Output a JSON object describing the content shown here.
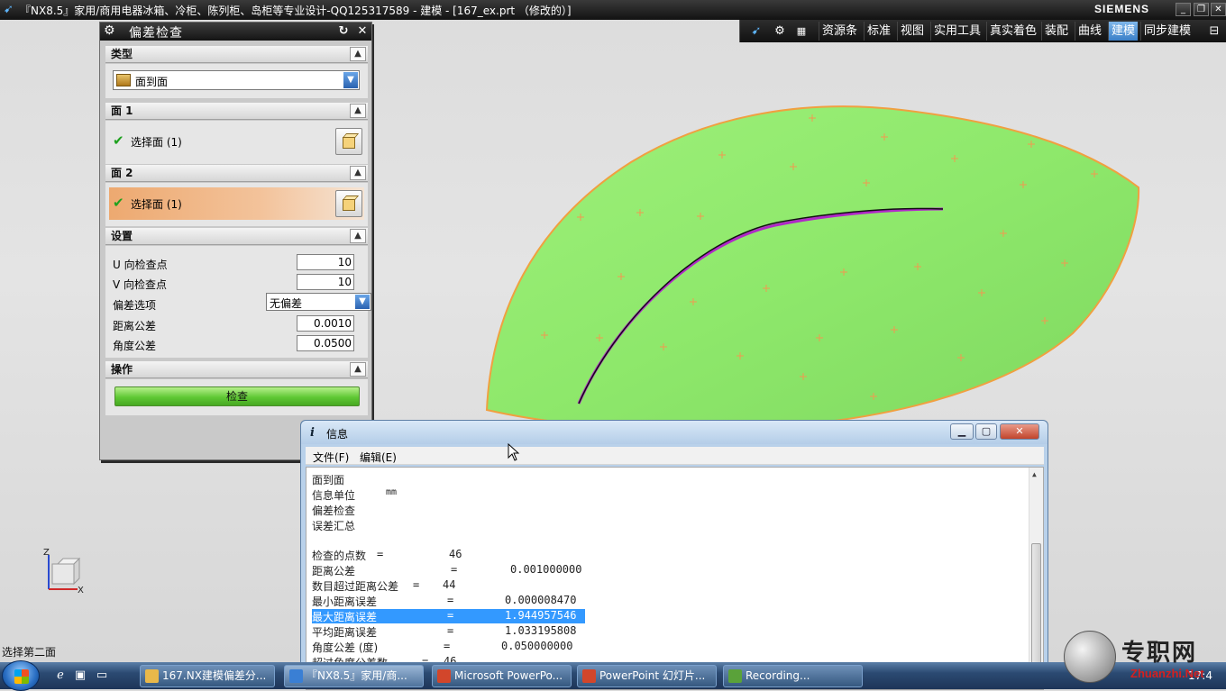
{
  "window": {
    "title": "『NX8.5』家用/商用电器冰箱、冷柜、陈列柜、岛柜等专业设计-QQ125317589 - 建模 - [167_ex.prt （修改的）]",
    "brand": "SIEMENS"
  },
  "toolbar": {
    "tabs": [
      "资源条",
      "标准",
      "视图",
      "实用工具",
      "真实着色",
      "装配",
      "曲线",
      "建模",
      "同步建模"
    ],
    "active_tab": "建模"
  },
  "dialog": {
    "title": "偏差检查",
    "type_section": {
      "label": "类型",
      "value": "面到面"
    },
    "face1_section": {
      "label": "面 1",
      "selection": "选择面 (1)"
    },
    "face2_section": {
      "label": "面 2",
      "selection": "选择面 (1)"
    },
    "settings_section": {
      "label": "设置",
      "u_points_label": "U 向检查点",
      "u_points": "10",
      "v_points_label": "V 向检查点",
      "v_points": "10",
      "deviation_option_label": "偏差选项",
      "deviation_option": "无偏差",
      "distance_tol_label": "距离公差",
      "distance_tol": "0.0010",
      "angle_tol_label": "角度公差",
      "angle_tol": "0.0500"
    },
    "operation_section": {
      "label": "操作",
      "check_button": "检查"
    }
  },
  "info_window": {
    "title": "信息",
    "menu": [
      "文件(F)",
      "编辑(E)"
    ],
    "lines": [
      {
        "key": "面到面",
        "eq": "",
        "value": ""
      },
      {
        "key": "信息单位",
        "eq": "",
        "value": "mm"
      },
      {
        "key": "偏差检查",
        "eq": "",
        "value": ""
      },
      {
        "key": "误差汇总",
        "eq": "",
        "value": ""
      },
      {
        "key": "",
        "eq": "",
        "value": ""
      },
      {
        "key": "检查的点数",
        "eq": "=",
        "value": "46"
      },
      {
        "key": "距离公差",
        "eq": "=",
        "value": "0.001000000"
      },
      {
        "key": "数目超过距离公差",
        "eq": "=",
        "value": "44"
      },
      {
        "key": "最小距离误差",
        "eq": "=",
        "value": "0.000008470"
      },
      {
        "key": "最大距离误差",
        "eq": "=",
        "value": "1.944957546"
      },
      {
        "key": "平均距离误差",
        "eq": "=",
        "value": "1.033195808"
      },
      {
        "key": "角度公差 (度)",
        "eq": "=",
        "value": "0.050000000"
      },
      {
        "key": "超过角度公差数",
        "eq": "=",
        "value": "46"
      }
    ]
  },
  "axis": {
    "z": "Z",
    "x": "X"
  },
  "status_text": "选择第二面",
  "taskbar": {
    "tasks": [
      {
        "label": "167.NX建模偏差分...",
        "icon_color": "#e8b84a"
      },
      {
        "label": "『NX8.5』家用/商...",
        "icon_color": "#3a7fd4"
      },
      {
        "label": "Microsoft PowerPo...",
        "icon_color": "#d2462b"
      },
      {
        "label": "PowerPoint 幻灯片...",
        "icon_color": "#d2462b"
      },
      {
        "label": "Recording...",
        "icon_color": "#5aa23a"
      }
    ],
    "clock": "17:4"
  },
  "watermark": {
    "cn": "专职网",
    "en": "Zhuanzhi.Net"
  }
}
